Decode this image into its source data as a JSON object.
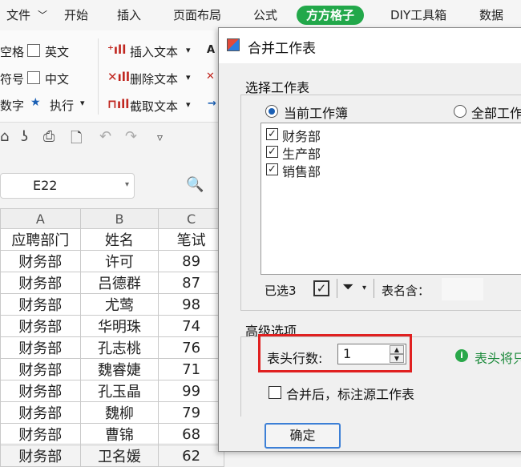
{
  "tabs": [
    "文件",
    "开始",
    "插入",
    "页面布局",
    "公式",
    "方方格子",
    "DIY工具箱",
    "数据"
  ],
  "ribbon": {
    "left_items": [
      "空格",
      "英文",
      "符号",
      "中文",
      "数字",
      "执行"
    ],
    "middle_items": [
      "插入文本",
      "删除文本",
      "截取文本"
    ]
  },
  "namebox": "E22",
  "sheet": {
    "columns": [
      "A",
      "B",
      "C"
    ],
    "headers": [
      "应聘部门",
      "姓名",
      "笔试"
    ],
    "rows": [
      [
        "财务部",
        "许可",
        "89"
      ],
      [
        "财务部",
        "吕德群",
        "87"
      ],
      [
        "财务部",
        "尤莺",
        "98"
      ],
      [
        "财务部",
        "华明珠",
        "74"
      ],
      [
        "财务部",
        "孔志桃",
        "76"
      ],
      [
        "财务部",
        "魏睿婕",
        "71"
      ],
      [
        "财务部",
        "孔玉晶",
        "99"
      ],
      [
        "财务部",
        "魏柳",
        "79"
      ],
      [
        "财务部",
        "曹锦",
        "68"
      ],
      [
        "财务部",
        "卫名媛",
        "62"
      ]
    ]
  },
  "dialog": {
    "title": "合并工作表",
    "select_group": "选择工作表",
    "radio_current": "当前工作簿",
    "radio_all": "全部工作",
    "sheets": [
      "财务部",
      "生产部",
      "销售部"
    ],
    "selected_count": "已选3",
    "name_contains": "表名含：",
    "advanced_group": "高级选项",
    "header_rows_label": "表头行数:",
    "header_rows_value": "1",
    "hint": "表头将只",
    "mark_source": "合并后，标注源工作表",
    "ok_button": "确定"
  },
  "colors": {
    "accent_tab": "#22a84a",
    "highlight_box": "#e02020"
  }
}
